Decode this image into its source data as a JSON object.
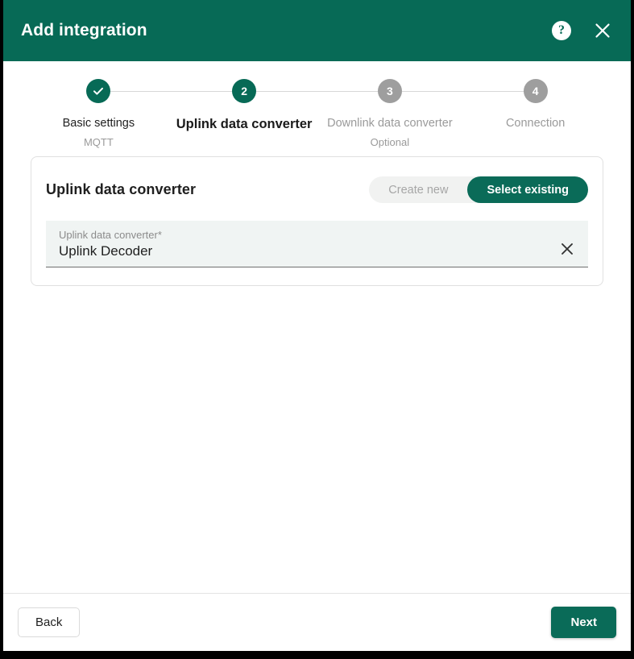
{
  "header": {
    "title": "Add integration",
    "help_icon": "help-circle-icon",
    "close_icon": "close-icon"
  },
  "stepper": {
    "steps": [
      {
        "number": "1",
        "display": "check",
        "label": "Basic settings",
        "sublabel": "MQTT",
        "state": "done"
      },
      {
        "number": "2",
        "display": "2",
        "label": "Uplink data converter",
        "sublabel": "",
        "state": "active"
      },
      {
        "number": "3",
        "display": "3",
        "label": "Downlink data converter",
        "sublabel": "Optional",
        "state": "pending"
      },
      {
        "number": "4",
        "display": "4",
        "label": "Connection",
        "sublabel": "",
        "state": "pending"
      }
    ]
  },
  "card": {
    "title": "Uplink data converter",
    "toggle": {
      "options": [
        "Create new",
        "Select existing"
      ],
      "selected": "Select existing"
    },
    "field": {
      "label": "Uplink data converter*",
      "value": "Uplink Decoder",
      "clear_icon": "close-icon"
    }
  },
  "footer": {
    "back_label": "Back",
    "next_label": "Next"
  },
  "colors": {
    "brand_green": "#076a56",
    "button_green": "#0a6b58",
    "step_pending_gray": "#9e9e9e",
    "field_bg": "#f0f4f3",
    "toggle_track": "#f1f2f1"
  }
}
